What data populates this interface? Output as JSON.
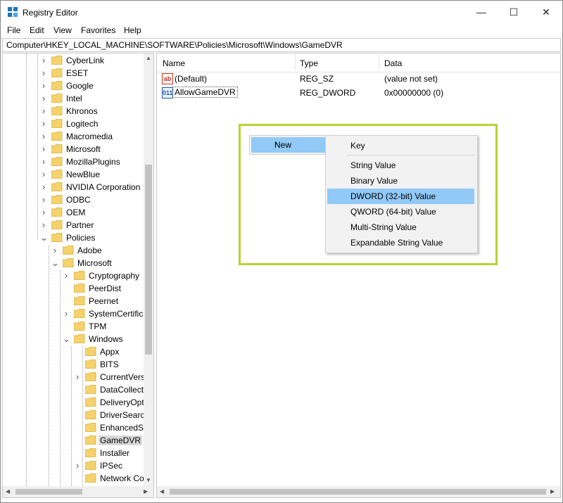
{
  "window": {
    "title": "Registry Editor",
    "controls": {
      "minimize": "—",
      "maximize": "☐",
      "close": "✕"
    }
  },
  "menu": [
    "File",
    "Edit",
    "View",
    "Favorites",
    "Help"
  ],
  "address": "Computer\\HKEY_LOCAL_MACHINE\\SOFTWARE\\Policies\\Microsoft\\Windows\\GameDVR",
  "tree": {
    "level1": [
      "CyberLink",
      "ESET",
      "Google",
      "Intel",
      "Khronos",
      "Logitech",
      "Macromedia",
      "Microsoft",
      "MozillaPlugins",
      "NewBlue",
      "NVIDIA Corporation",
      "ODBC",
      "OEM",
      "Partner",
      "Policies"
    ],
    "policies_children": [
      "Adobe",
      "Microsoft"
    ],
    "microsoft_children": [
      "Cryptography",
      "PeerDist",
      "Peernet",
      "SystemCertific",
      "TPM",
      "Windows"
    ],
    "windows_children": [
      "Appx",
      "BITS",
      "CurrentVers",
      "DataCollect",
      "DeliveryOpt",
      "DriverSearc",
      "EnhancedS",
      "GameDVR",
      "Installer",
      "IPSec",
      "Network Co"
    ],
    "selected": "GameDVR"
  },
  "list": {
    "columns": [
      "Name",
      "Type",
      "Data"
    ],
    "rows": [
      {
        "icon": "string-value-icon",
        "name": "(Default)",
        "type": "REG_SZ",
        "data": "(value not set)"
      },
      {
        "icon": "binary-value-icon",
        "name": "AllowGameDVR",
        "type": "REG_DWORD",
        "data": "0x00000000 (0)"
      }
    ]
  },
  "context_menu": {
    "new_label": "New",
    "submenu": [
      "Key",
      "String Value",
      "Binary Value",
      "DWORD (32-bit) Value",
      "QWORD (64-bit) Value",
      "Multi-String Value",
      "Expandable String Value"
    ],
    "highlighted": "DWORD (32-bit) Value"
  },
  "colors": {
    "highlight_box": "#b5d334",
    "menu_selection": "#91c9f7",
    "folder": "#f5d26b"
  }
}
